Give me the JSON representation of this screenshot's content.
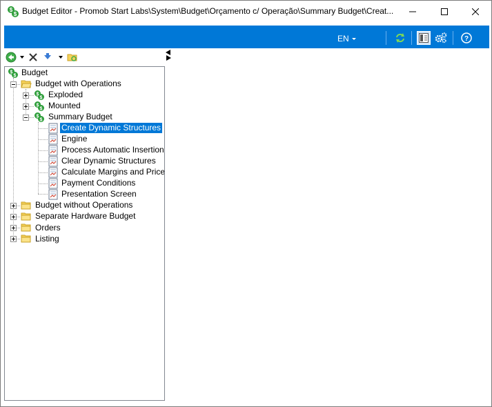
{
  "window": {
    "title": "Budget Editor - Promob Start Labs\\System\\Budget\\Orçamento c/ Operação\\Summary Budget\\Creat..."
  },
  "toolbar": {
    "language": "EN"
  },
  "tree": {
    "root": "Budget",
    "nodes": [
      {
        "label": "Budget with Operations"
      },
      {
        "label": "Exploded"
      },
      {
        "label": "Mounted"
      },
      {
        "label": "Summary Budget"
      },
      {
        "label": "Create Dynamic Structures"
      },
      {
        "label": "Engine"
      },
      {
        "label": "Process Automatic Insertion"
      },
      {
        "label": "Clear Dynamic Structures"
      },
      {
        "label": "Calculate Margins and Prices"
      },
      {
        "label": "Payment Conditions"
      },
      {
        "label": "Presentation Screen"
      },
      {
        "label": "Budget without Operations"
      },
      {
        "label": "Separate Hardware Budget"
      },
      {
        "label": "Orders"
      },
      {
        "label": "Listing"
      }
    ]
  },
  "icons": {
    "app": "money-dollar-icon",
    "folder": "folder-icon",
    "dollar": "green-dollar-icon",
    "script": "script-page-icon"
  }
}
